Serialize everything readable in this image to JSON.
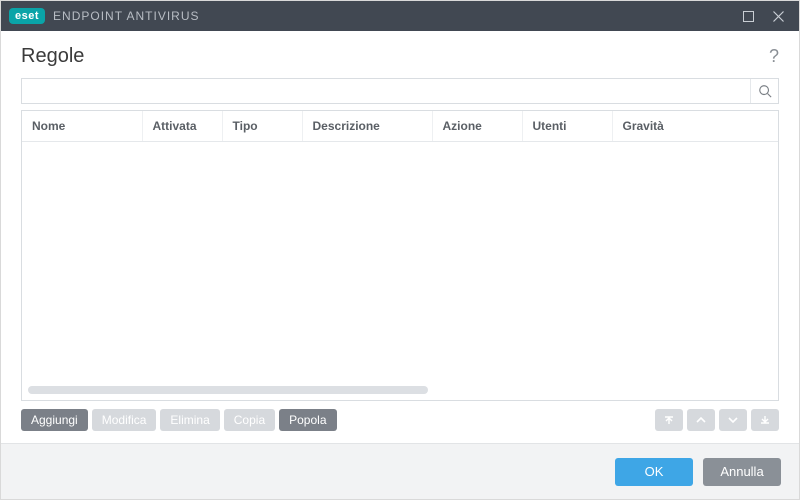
{
  "titlebar": {
    "brand_badge": "eset",
    "product_name": "ENDPOINT ANTIVIRUS"
  },
  "heading": {
    "title": "Regole",
    "help_tooltip": "?"
  },
  "search": {
    "value": "",
    "placeholder": ""
  },
  "table": {
    "columns": [
      "Nome",
      "Attivata",
      "Tipo",
      "Descrizione",
      "Azione",
      "Utenti",
      "Gravità"
    ],
    "rows": []
  },
  "actions": {
    "add": "Aggiungi",
    "edit": "Modifica",
    "delete": "Elimina",
    "copy": "Copia",
    "populate": "Popola"
  },
  "footer": {
    "ok": "OK",
    "cancel": "Annulla"
  }
}
